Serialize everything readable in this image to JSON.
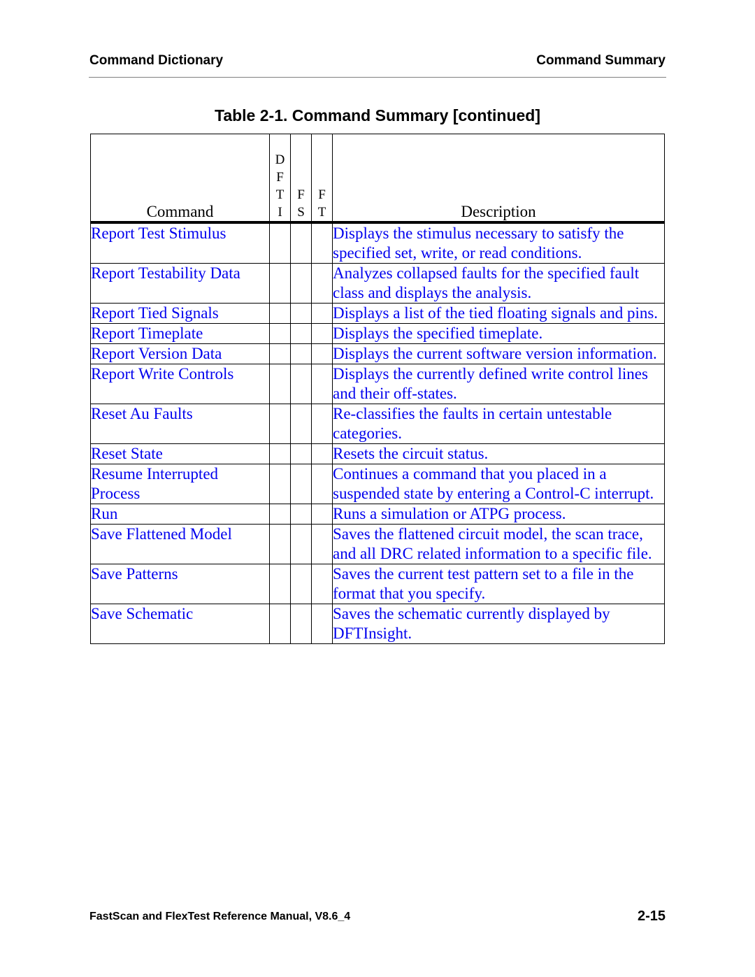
{
  "header": {
    "left": "Command Dictionary",
    "right": "Command Summary"
  },
  "table_title": "Table 2-1. Command Summary [continued]",
  "columns": {
    "command": "Command",
    "dfti": "D\nF\nT\nI",
    "fs": "F\nS",
    "ft": "F\nT",
    "description": "Description"
  },
  "rows": [
    {
      "command": "Report Test Stimulus",
      "description": "Displays the stimulus necessary to satisfy the specified set, write, or read conditions."
    },
    {
      "command": "Report Testability Data",
      "description": "Analyzes collapsed faults for the specified fault class and displays the analysis."
    },
    {
      "command": "Report Tied Signals",
      "description": "Displays a list of the tied floating signals and pins."
    },
    {
      "command": "Report Timeplate",
      "description": "Displays the specified timeplate."
    },
    {
      "command": "Report Version Data",
      "description": "Displays the current software version information."
    },
    {
      "command": "Report Write Controls",
      "description": "Displays the currently defined write control lines and their off-states."
    },
    {
      "command": "Reset Au Faults",
      "description": "Re-classifies the faults in certain untestable categories."
    },
    {
      "command": "Reset State",
      "description": "Resets the circuit status."
    },
    {
      "command": "Resume Interrupted Process",
      "description": "Continues a command that you placed in a suspended state by entering a Control-C interrupt."
    },
    {
      "command": "Run",
      "description": "Runs a simulation or ATPG process."
    },
    {
      "command": "Save Flattened Model",
      "description": "Saves the flattened circuit model, the scan trace, and all DRC related information to a specific file."
    },
    {
      "command": "Save Patterns",
      "description": "Saves the current test pattern set to a file in the format that you specify."
    },
    {
      "command": "Save Schematic",
      "description": "Saves the schematic currently displayed by DFTInsight."
    }
  ],
  "footer": {
    "manual": "FastScan and FlexTest Reference Manual, V8.6_4",
    "page": "2-15"
  },
  "colors": {
    "link": "#0000ee",
    "text": "#000000",
    "rule": "#808080"
  }
}
